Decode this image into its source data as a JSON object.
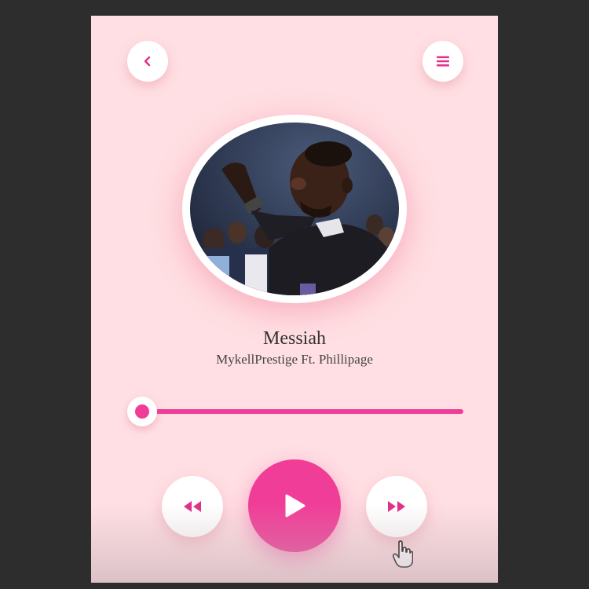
{
  "player": {
    "title": "Messiah",
    "artist": "MykellPrestige Ft. Phillipage",
    "progress_fraction": 0.0
  },
  "icons": {
    "back": "chevron-left-icon",
    "menu": "menu-icon",
    "rewind": "rewind-icon",
    "play": "play-icon",
    "fast_forward": "fast-forward-icon",
    "cursor": "hand-pointer-icon"
  },
  "colors": {
    "accent": "#f03e98",
    "background": "#ffdfe3",
    "button": "#ffffff"
  }
}
